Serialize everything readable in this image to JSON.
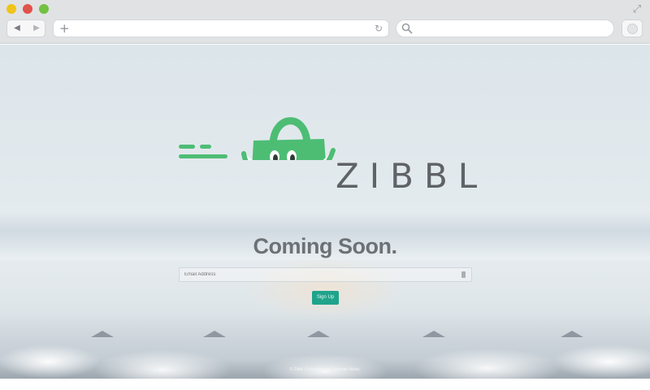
{
  "browser": {
    "back_icon": "back-arrow-icon",
    "forward_icon": "forward-arrow-icon",
    "new_tab_icon": "plus-icon",
    "reload_icon": "reload-icon",
    "search_icon": "search-icon",
    "expand_icon": "expand-icon",
    "url_value": "",
    "search_value": ""
  },
  "page": {
    "brand_name": "ZIBBL",
    "heading": "Coming Soon.",
    "email_placeholder": "Email Address",
    "signup_label": "Sign Up",
    "footer_text": "© Zibbl | Developed by Talisman Webs.",
    "colors": {
      "brand_green": "#4dbd74",
      "button_teal": "#1fa48b",
      "text_gray": "#6d7176"
    }
  }
}
